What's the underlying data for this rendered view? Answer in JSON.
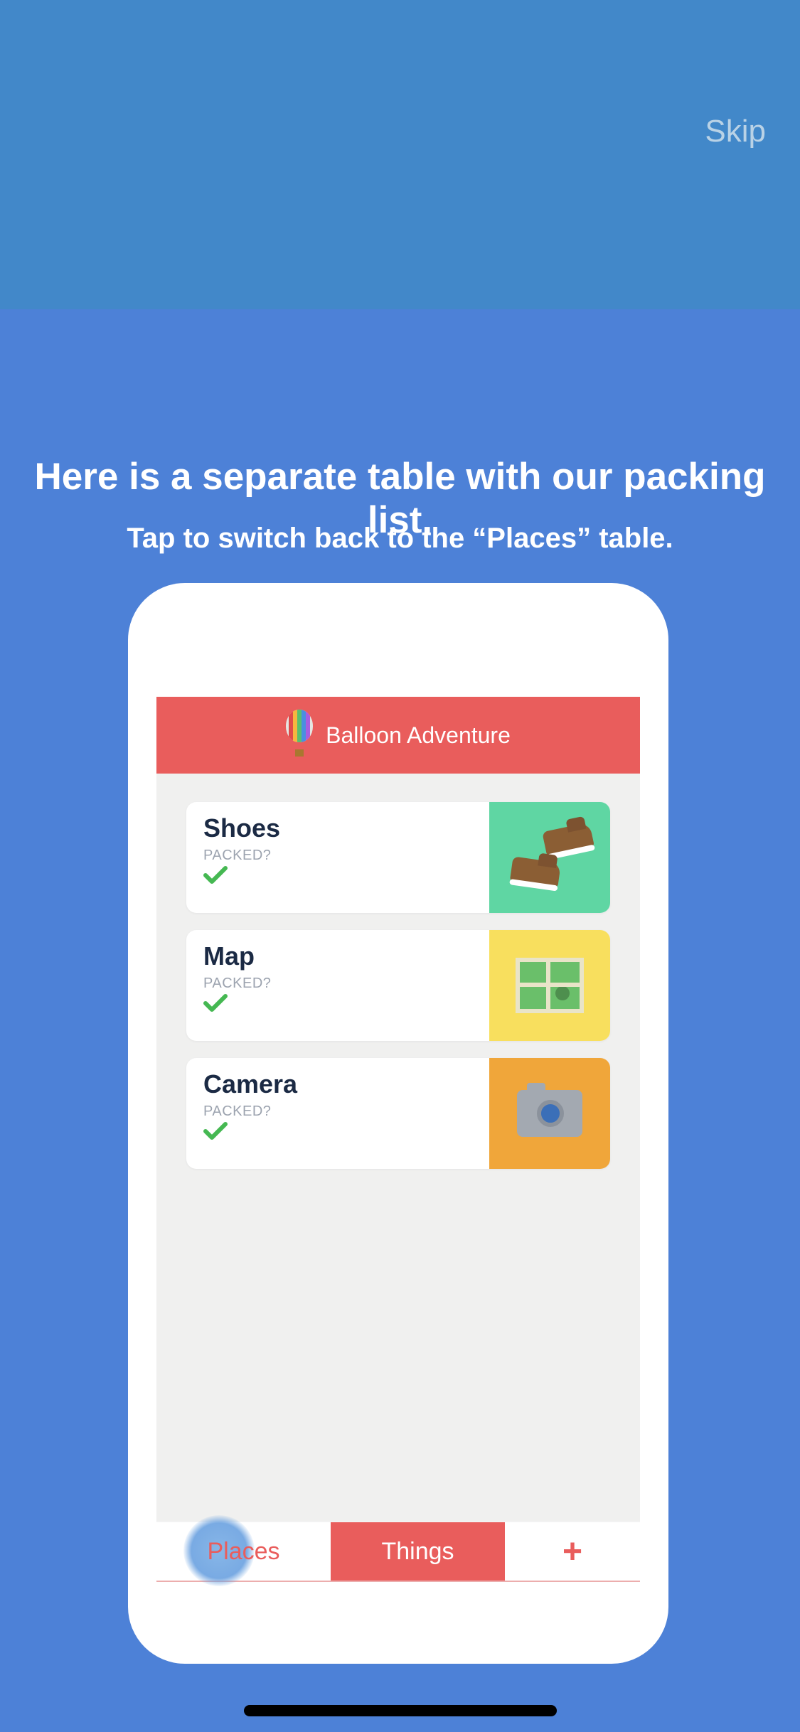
{
  "onboarding": {
    "skip_label": "Skip",
    "heading": "Here is a separate table with our packing list.",
    "subheading": "Tap to switch back to the “Places” table."
  },
  "app": {
    "title": "Balloon Adventure"
  },
  "items": [
    {
      "name": "Shoes",
      "sub": "PACKED?",
      "packed": true,
      "thumb": "shoes",
      "thumb_color": "green"
    },
    {
      "name": "Map",
      "sub": "PACKED?",
      "packed": true,
      "thumb": "map",
      "thumb_color": "yellow"
    },
    {
      "name": "Camera",
      "sub": "PACKED?",
      "packed": true,
      "thumb": "camera",
      "thumb_color": "orange"
    }
  ],
  "tabs": {
    "places": "Places",
    "things": "Things",
    "add": "+",
    "active": "Things",
    "highlighted": "Places"
  }
}
